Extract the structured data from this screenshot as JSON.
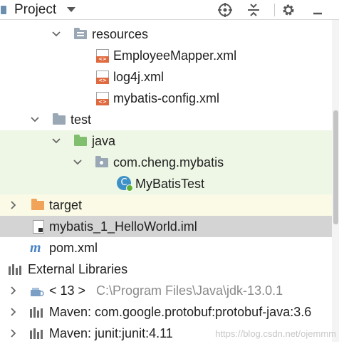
{
  "header": {
    "title": "Project",
    "tools": [
      "locate-icon",
      "collapse-icon",
      "gear-icon",
      "hide-icon"
    ]
  },
  "colors": {
    "test_bg": "#eef7e6",
    "target_bg": "#fafae6",
    "selected_bg": "#d4d4d4",
    "folder": "#9aa7b4",
    "java_folder": "#7fbf6d",
    "target_folder": "#f2a35a"
  },
  "tree": {
    "resources": "resources",
    "employee_mapper": "EmployeeMapper.xml",
    "log4j": "log4j.xml",
    "mybatis_config": "mybatis-config.xml",
    "test": "test",
    "java": "java",
    "package": "com.cheng.mybatis",
    "mybatis_test": "MyBatisTest",
    "target": "target",
    "iml": "mybatis_1_HelloWorld.iml",
    "pom": "pom.xml",
    "external_libraries": "External Libraries",
    "jdk_name": "< 13 >",
    "jdk_path": "C:\\Program Files\\Java\\jdk-13.0.1",
    "protobuf": "Maven: com.google.protobuf:protobuf-java:3.6",
    "junit": "Maven: junit:junit:4.11"
  },
  "watermark": "https://blog.csdn.net/ojemmm"
}
